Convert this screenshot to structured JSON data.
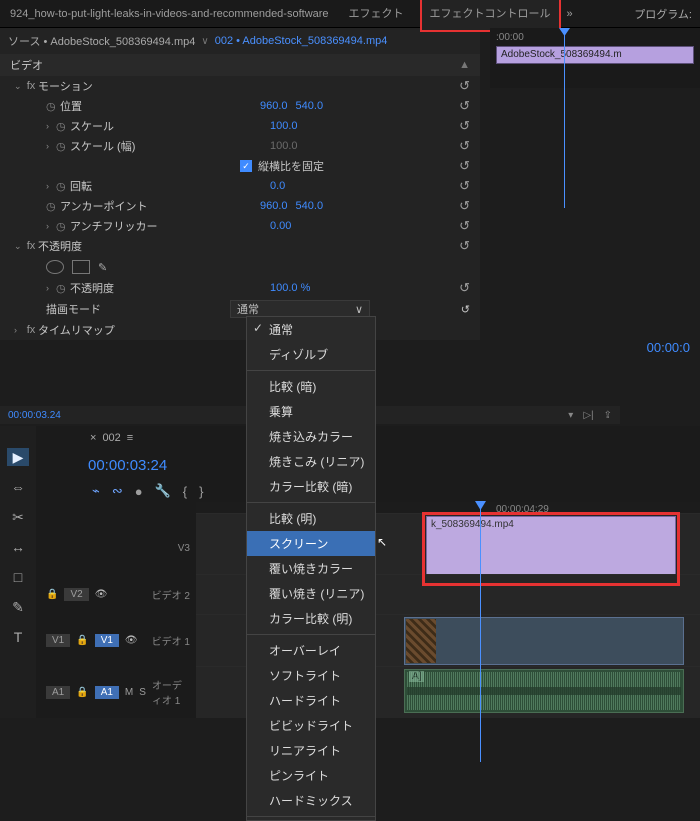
{
  "tabbar": {
    "project": "924_how-to-put-light-leaks-in-videos-and-recommended-software",
    "effects": "エフェクト",
    "effect_controls": "エフェクトコントロール",
    "menu_glyph": "»",
    "program": "プログラム:"
  },
  "ec_header": {
    "source_prefix": "ソース • ",
    "source": "AdobeStock_508369494.mp4",
    "seq": "002 • AdobeStock_508369494.mp4"
  },
  "timeline_top": {
    "ruler_start": ":00:00",
    "clip_name": "AdobeStock_508369494.m"
  },
  "video_label": "ビデオ",
  "motion": {
    "label": "モーション",
    "position_label": "位置",
    "position_x": "960.0",
    "position_y": "540.0",
    "scale_label": "スケール",
    "scale": "100.0",
    "scale_w_label": "スケール (幅)",
    "scale_w": "100.0",
    "uniform_label": "縦横比を固定",
    "rotation_label": "回転",
    "rotation": "0.0",
    "anchor_label": "アンカーポイント",
    "anchor_x": "960.0",
    "anchor_y": "540.0",
    "antiflicker_label": "アンチフリッカー",
    "antiflicker": "0.00"
  },
  "opacity": {
    "label": "不透明度",
    "value_label": "不透明度",
    "value": "100.0 %",
    "blend_label": "描画モード",
    "blend_selected": "通常"
  },
  "timeremap": {
    "label": "タイムリマップ"
  },
  "dropdown": {
    "items": [
      "通常",
      "ディゾルブ",
      "比較 (暗)",
      "乗算",
      "焼き込みカラー",
      "焼きこみ (リニア)",
      "カラー比較 (暗)",
      "比較 (明)",
      "スクリーン",
      "覆い焼きカラー",
      "覆い焼き (リニア)",
      "カラー比較 (明)",
      "オーバーレイ",
      "ソフトライト",
      "ハードライト",
      "ビビッドライト",
      "リニアライト",
      "ピンライト",
      "ハードミックス"
    ],
    "checked_index": 0,
    "hover_index": 8
  },
  "ec_footer": {
    "tc": "00:00:03.24"
  },
  "right_tc": "00:00:0",
  "seq": {
    "tab": "002",
    "tc": "00:00:03:24",
    "ruler_tick": "00:00:04:29",
    "tracks": {
      "v3": "V3",
      "v2": "V2",
      "v2_label": "ビデオ 2",
      "v1": "V1",
      "v1_label": "ビデオ 1",
      "a1_src": "A1",
      "a1": "A1",
      "a1_label": "オーディオ 1",
      "m": "M",
      "s": "S"
    },
    "clip_v3": "k_508369494.mp4",
    "clip_a1": "A]"
  },
  "tools": [
    "▶",
    "⇔",
    "✂",
    "↔",
    "□",
    "✎",
    "T"
  ],
  "glyph": {
    "reset": "↺",
    "stopwatch": "◷",
    "fx": "fx",
    "tri_r": "›",
    "tri_d": "⌄",
    "chev": "∨",
    "x": "×",
    "burger": "≡",
    "lock": "🔒",
    "eye": "👁",
    "filter": "▾",
    "play_ins": "▷|",
    "share": "⇪",
    "magnet": "⌁",
    "link": "∾",
    "wrench": "🔧",
    "marker": "●",
    "lsq": "{",
    "rsq": "}"
  }
}
